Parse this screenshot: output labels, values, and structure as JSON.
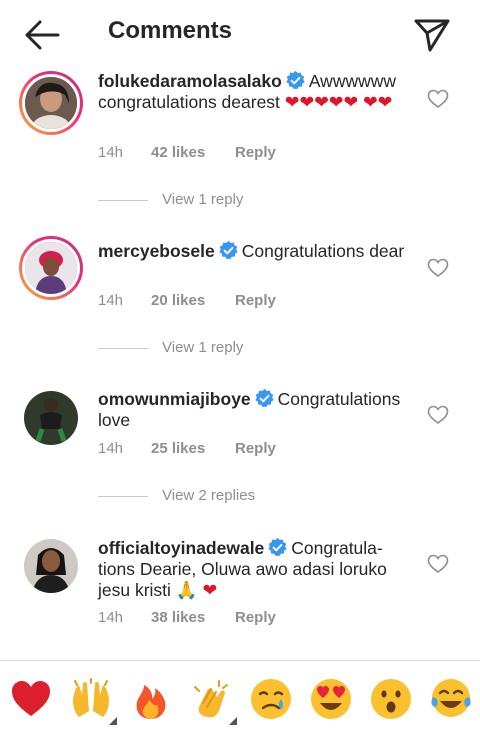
{
  "header": {
    "title": "Comments",
    "back_icon": "arrow-left-icon",
    "send_icon": "paper-plane-icon"
  },
  "colors": {
    "verified": "#3897f0",
    "heart": "#e0152b",
    "muted": "#8e8e8e",
    "text": "#262626"
  },
  "comments": [
    {
      "username": "folukedaramolasalako",
      "text": "Awwwwww congratulations dearest",
      "hearts_line1": "❤❤❤❤❤",
      "hearts_line2": "❤❤",
      "time": "14h",
      "likes": "42 likes",
      "reply": "Reply",
      "view_replies": "View 1 reply"
    },
    {
      "username": "mercyebosele",
      "text": "Congratulations dear",
      "time": "14h",
      "likes": "20 likes",
      "reply": "Reply",
      "view_replies": "View 1 reply"
    },
    {
      "username": "omowunmiajiboye",
      "text": "Congratulations love",
      "time": "14h",
      "likes": "25 likes",
      "reply": "Reply",
      "view_replies": "View 2 replies"
    },
    {
      "username": "officialtoyinadewale",
      "text": "Congratula-tions Dearie, Oluwa awo adasi loruko jesu kristi",
      "emoji_tail": "🙏",
      "heart_tail": "❤",
      "time": "14h",
      "likes": "38 likes",
      "reply": "Reply"
    }
  ],
  "emoji_bar": [
    "red-heart-icon",
    "raising-hands-icon",
    "fire-icon",
    "clapping-hands-icon",
    "crying-face-icon",
    "heart-eyes-face-icon",
    "surprised-face-icon",
    "tears-of-joy-face-icon"
  ]
}
